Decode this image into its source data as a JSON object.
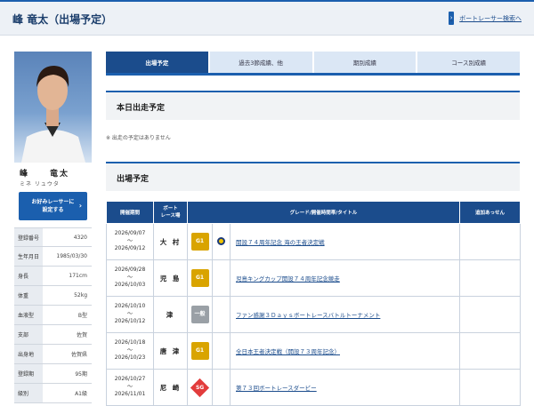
{
  "header": {
    "title": "峰 竜太（出場予定）",
    "search_link": "ボートレーサー検索へ"
  },
  "profile": {
    "name_family": "峰",
    "name_given": "竜太",
    "kana": "ミネ リュウタ",
    "favorite_button": "お好みレーサーに\n設定する",
    "info": [
      {
        "label": "登録番号",
        "value": "4320"
      },
      {
        "label": "生年月日",
        "value": "1985/03/30"
      },
      {
        "label": "身長",
        "value": "171cm"
      },
      {
        "label": "体重",
        "value": "52kg"
      },
      {
        "label": "血液型",
        "value": "B型"
      },
      {
        "label": "支部",
        "value": "佐賀"
      },
      {
        "label": "出身地",
        "value": "佐賀県"
      },
      {
        "label": "登録期",
        "value": "95期"
      },
      {
        "label": "級別",
        "value": "A1級"
      }
    ]
  },
  "tabs": [
    {
      "label": "出場予定"
    },
    {
      "label": "過去3節成績、他"
    },
    {
      "label": "期別成績"
    },
    {
      "label": "コース別成績"
    }
  ],
  "today": {
    "heading": "本日出走予定",
    "note": "※ 出走の予定はありません"
  },
  "schedule": {
    "heading": "出場予定",
    "columns": [
      "開催期間",
      "ボート\nレース場",
      "グレード/開催時間帯/タイトル",
      "追加あっせん"
    ],
    "rows": [
      {
        "start": "2026/09/07",
        "sep": "〜",
        "end": "2026/09/12",
        "venue": "大 村",
        "grade": "G1",
        "grade_type": "g1",
        "time_icon": "moon-icon",
        "title": "開設７４周年記念 海の王者決定戦"
      },
      {
        "start": "2026/09/28",
        "sep": "〜",
        "end": "2026/10/03",
        "venue": "児 島",
        "grade": "G1",
        "grade_type": "g1",
        "time_icon": "",
        "title": "児島キングカップ開設７４周年記念競走"
      },
      {
        "start": "2026/10/10",
        "sep": "〜",
        "end": "2026/10/12",
        "venue": "津",
        "grade": "一般",
        "grade_type": "gen",
        "time_icon": "",
        "title": "ファン感謝３Ｄａｙｓボートレースバトルトーナメント"
      },
      {
        "start": "2026/10/18",
        "sep": "〜",
        "end": "2026/10/23",
        "venue": "唐 津",
        "grade": "G1",
        "grade_type": "g1",
        "time_icon": "",
        "title": "全日本王者決定戦（開設７３周年記念）"
      },
      {
        "start": "2026/10/27",
        "sep": "〜",
        "end": "2026/11/01",
        "venue": "尼 崎",
        "grade": "SG",
        "grade_type": "sg",
        "time_icon": "",
        "title": "第７３回ボートレースダービー"
      }
    ]
  },
  "colors": {
    "accent": "#1b4c8c",
    "g1": "#d9a400",
    "sg": "#e23c3c",
    "general": "#9aa0a6"
  }
}
